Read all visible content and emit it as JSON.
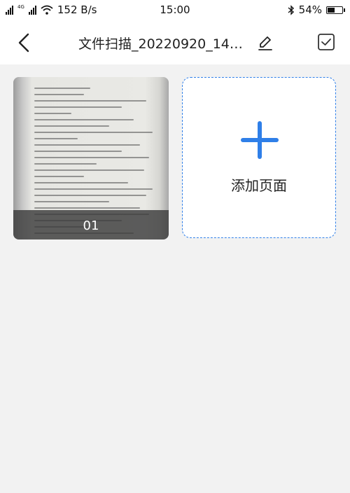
{
  "status_bar": {
    "network_type": "4G",
    "speed": "152 B/s",
    "time": "15:00",
    "battery": "54%",
    "battery_level": 0.54
  },
  "header": {
    "title": "文件扫描_20220920_145...",
    "back_icon": "chevron-left-icon",
    "edit_icon": "pencil-icon",
    "select_icon": "checkbox-icon"
  },
  "pages": [
    {
      "number": "01"
    }
  ],
  "add_page": {
    "label": "添加页面",
    "color": "#2f7fe8"
  }
}
